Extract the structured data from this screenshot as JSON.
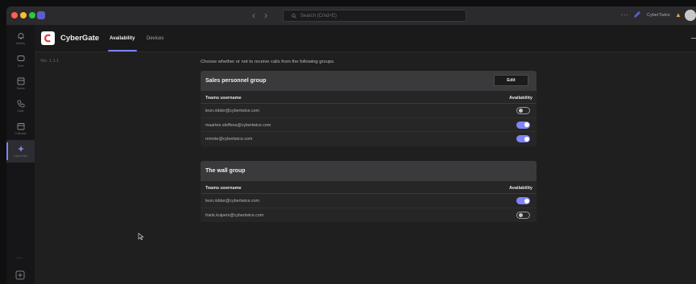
{
  "titlebar": {
    "search_placeholder": "Search (Cmd+E)",
    "user_name": "CyberTwice",
    "back_arrow": "‹",
    "forward_arrow": "›",
    "more_glyph": "···"
  },
  "rail": {
    "items": [
      {
        "label": "Activity",
        "icon": "bell-icon"
      },
      {
        "label": "Chat",
        "icon": "chat-icon"
      },
      {
        "label": "Teams",
        "icon": "teams-icon"
      },
      {
        "label": "Calls",
        "icon": "phone-icon"
      },
      {
        "label": "Calendar",
        "icon": "calendar-icon"
      },
      {
        "label": "CyberGate",
        "icon": "cybergate-icon",
        "active": true
      }
    ],
    "more_glyph": "···",
    "apps_icon": "apps-icon"
  },
  "app": {
    "name": "CyberGate",
    "tabs": [
      {
        "label": "Availability",
        "active": true
      },
      {
        "label": "Devices",
        "active": false
      }
    ],
    "version": "Ver. 1.1.1"
  },
  "content": {
    "intro": "Choose whether or not to receive calls from the following groups.",
    "column_username": "Teams username",
    "column_availability": "Availability",
    "groups": [
      {
        "title": "Sales personnel group",
        "edit_label": "Edit",
        "members": [
          {
            "username": "leon.ridder@cybertwice.com",
            "available": false
          },
          {
            "username": "maarten.steffens@cybertwice.com",
            "available": true
          },
          {
            "username": "remote@cybertwice.com",
            "available": true
          }
        ]
      },
      {
        "title": "The wall group",
        "members": [
          {
            "username": "leon.ridder@cybertwice.com",
            "available": true
          },
          {
            "username": "frank.kuipers@cybertwice.com",
            "available": false
          }
        ]
      }
    ]
  },
  "colors": {
    "accent": "#7f85f5",
    "background": "#1f1f1f",
    "card_header": "#3a3a3c",
    "brand_logo": "#e03c3c"
  }
}
